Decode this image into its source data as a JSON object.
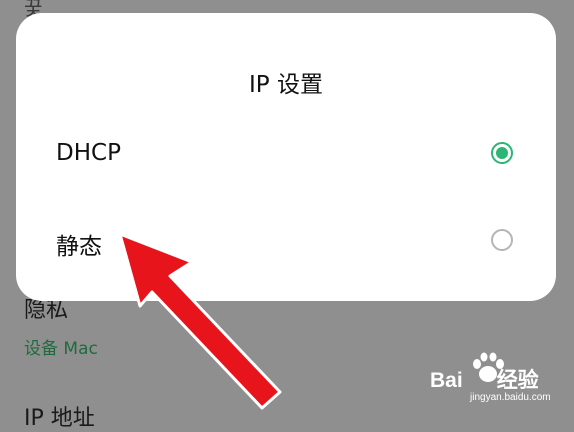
{
  "background": {
    "top_partial": "꿎",
    "privacy_title": "隐私",
    "privacy_subtitle": "设备 Mac",
    "ip_title": "IP 地址"
  },
  "dialog": {
    "title": "IP 设置",
    "options": [
      {
        "label": "DHCP",
        "selected": true
      },
      {
        "label": "静态",
        "selected": false
      }
    ]
  },
  "colors": {
    "accent_green": "#2bb673",
    "arrow_red": "#e8141c"
  },
  "watermark": {
    "brand_left": "Bai",
    "brand_right": "经验",
    "url": "jingyan.baidu.com"
  }
}
